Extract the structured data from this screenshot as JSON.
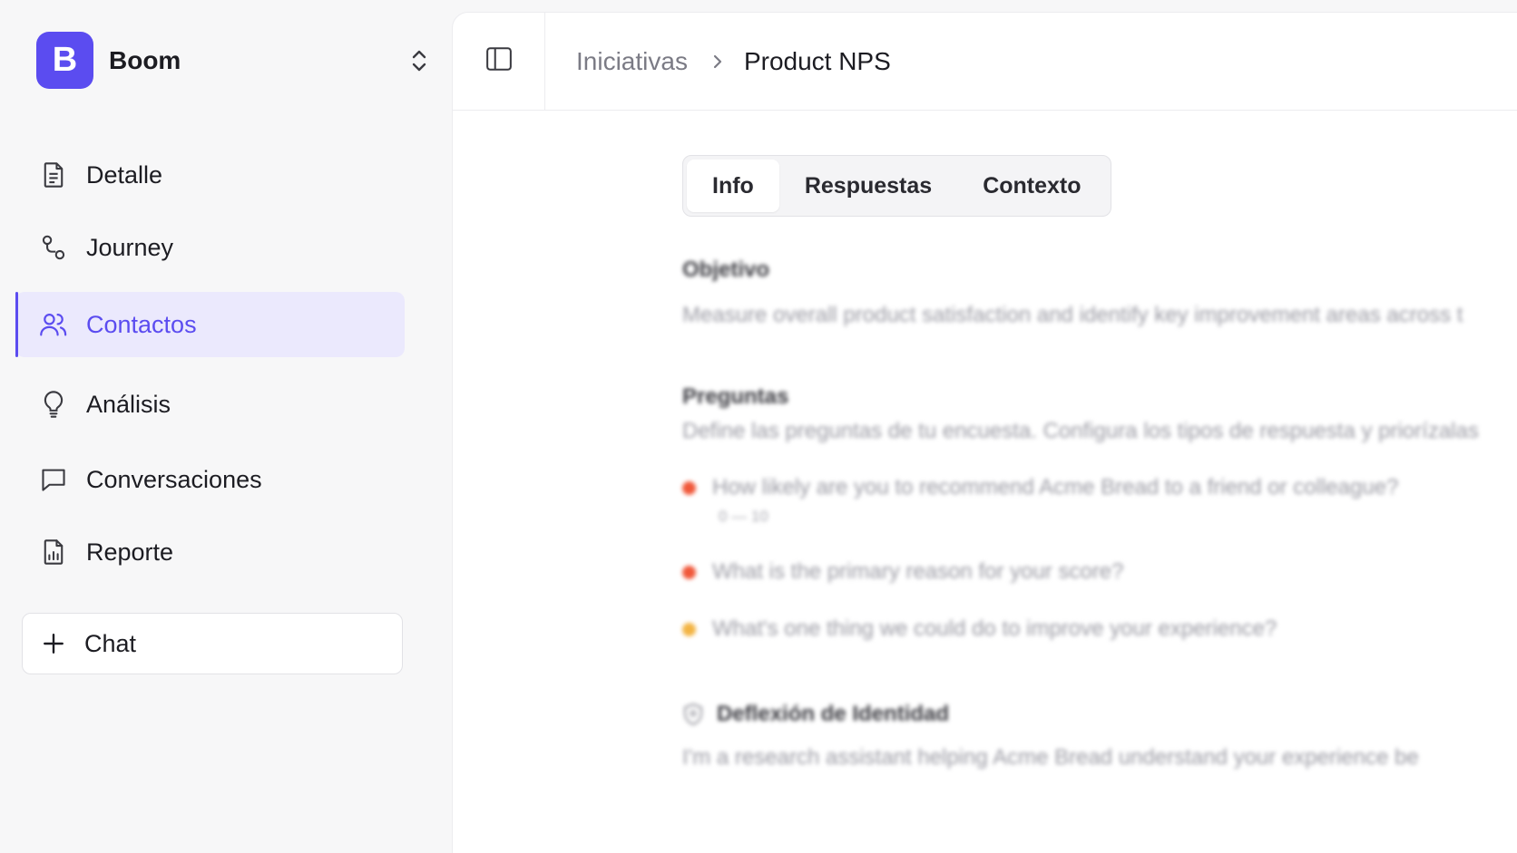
{
  "workspace": {
    "logo_letter": "B",
    "name": "Boom",
    "brand_color": "#5b4cf0"
  },
  "sidebar": {
    "items": [
      {
        "label": "Detalle",
        "icon": "document-icon"
      },
      {
        "label": "Journey",
        "icon": "route-icon"
      },
      {
        "label": "Contactos",
        "icon": "users-icon",
        "active": true
      },
      {
        "label": "Análisis",
        "icon": "lightbulb-icon"
      },
      {
        "label": "Conversaciones",
        "icon": "chat-bubble-icon"
      },
      {
        "label": "Reporte",
        "icon": "report-icon"
      }
    ],
    "new_chat_label": "Chat"
  },
  "header": {
    "breadcrumb_parent": "Iniciativas",
    "breadcrumb_current": "Product NPS"
  },
  "tabs": [
    {
      "label": "Info",
      "active": true
    },
    {
      "label": "Respuestas"
    },
    {
      "label": "Contexto"
    }
  ],
  "content": {
    "objective_title": "Objetivo",
    "objective_text": "Measure overall product satisfaction and identify key improvement areas across t",
    "questions_title": "Preguntas",
    "questions_subtitle": "Define las preguntas de tu encuesta. Configura los tipos de respuesta y priorízalas",
    "questions": [
      {
        "text": "How likely are you to recommend Acme Bread to a friend or colleague?",
        "range": "0 — 10",
        "dot_color": "#f0583a"
      },
      {
        "text": "What is the primary reason for your score?",
        "dot_color": "#f0583a"
      },
      {
        "text": "What's one thing we could do to improve your experience?",
        "dot_color": "#f3b443"
      }
    ],
    "deflection_title": "Deflexión de Identidad",
    "deflection_text": "I'm a research assistant helping Acme Bread understand your experience be"
  }
}
